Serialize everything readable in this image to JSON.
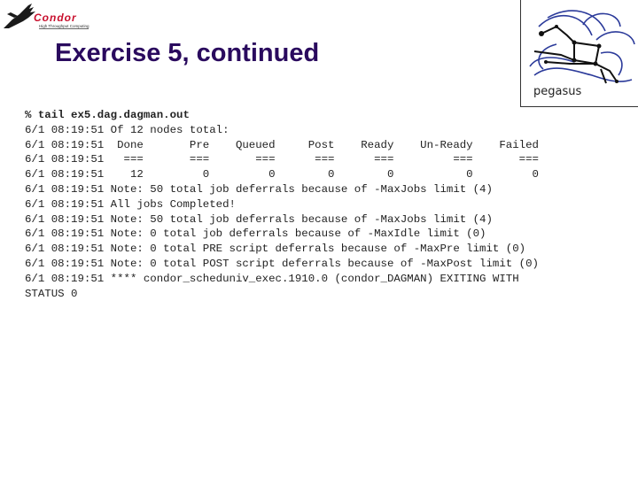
{
  "header": {
    "title": "Exercise 5, continued",
    "condor_logo": {
      "name": "Condor",
      "tagline": "High Throughput Computing",
      "color": "#c8102e"
    },
    "pegasus_logo": {
      "name": "pegasus"
    }
  },
  "terminal": {
    "command": "% tail ex5.dag.dagman.out",
    "lines": [
      "6/1 08:19:51 Of 12 nodes total:",
      "6/1 08:19:51  Done       Pre    Queued     Post    Ready    Un-Ready    Failed",
      "6/1 08:19:51   ===       ===       ===      ===      ===         ===       ===",
      "6/1 08:19:51    12         0         0        0        0           0         0",
      "6/1 08:19:51 Note: 50 total job deferrals because of -MaxJobs limit (4)",
      "6/1 08:19:51 All jobs Completed!",
      "6/1 08:19:51 Note: 50 total job deferrals because of -MaxJobs limit (4)",
      "6/1 08:19:51 Note: 0 total job deferrals because of -MaxIdle limit (0)",
      "6/1 08:19:51 Note: 0 total PRE script deferrals because of -MaxPre limit (0)",
      "6/1 08:19:51 Note: 0 total POST script deferrals because of -MaxPost limit (0)",
      "6/1 08:19:51 **** condor_scheduniv_exec.1910.0 (condor_DAGMAN) EXITING WITH",
      "STATUS 0"
    ]
  }
}
